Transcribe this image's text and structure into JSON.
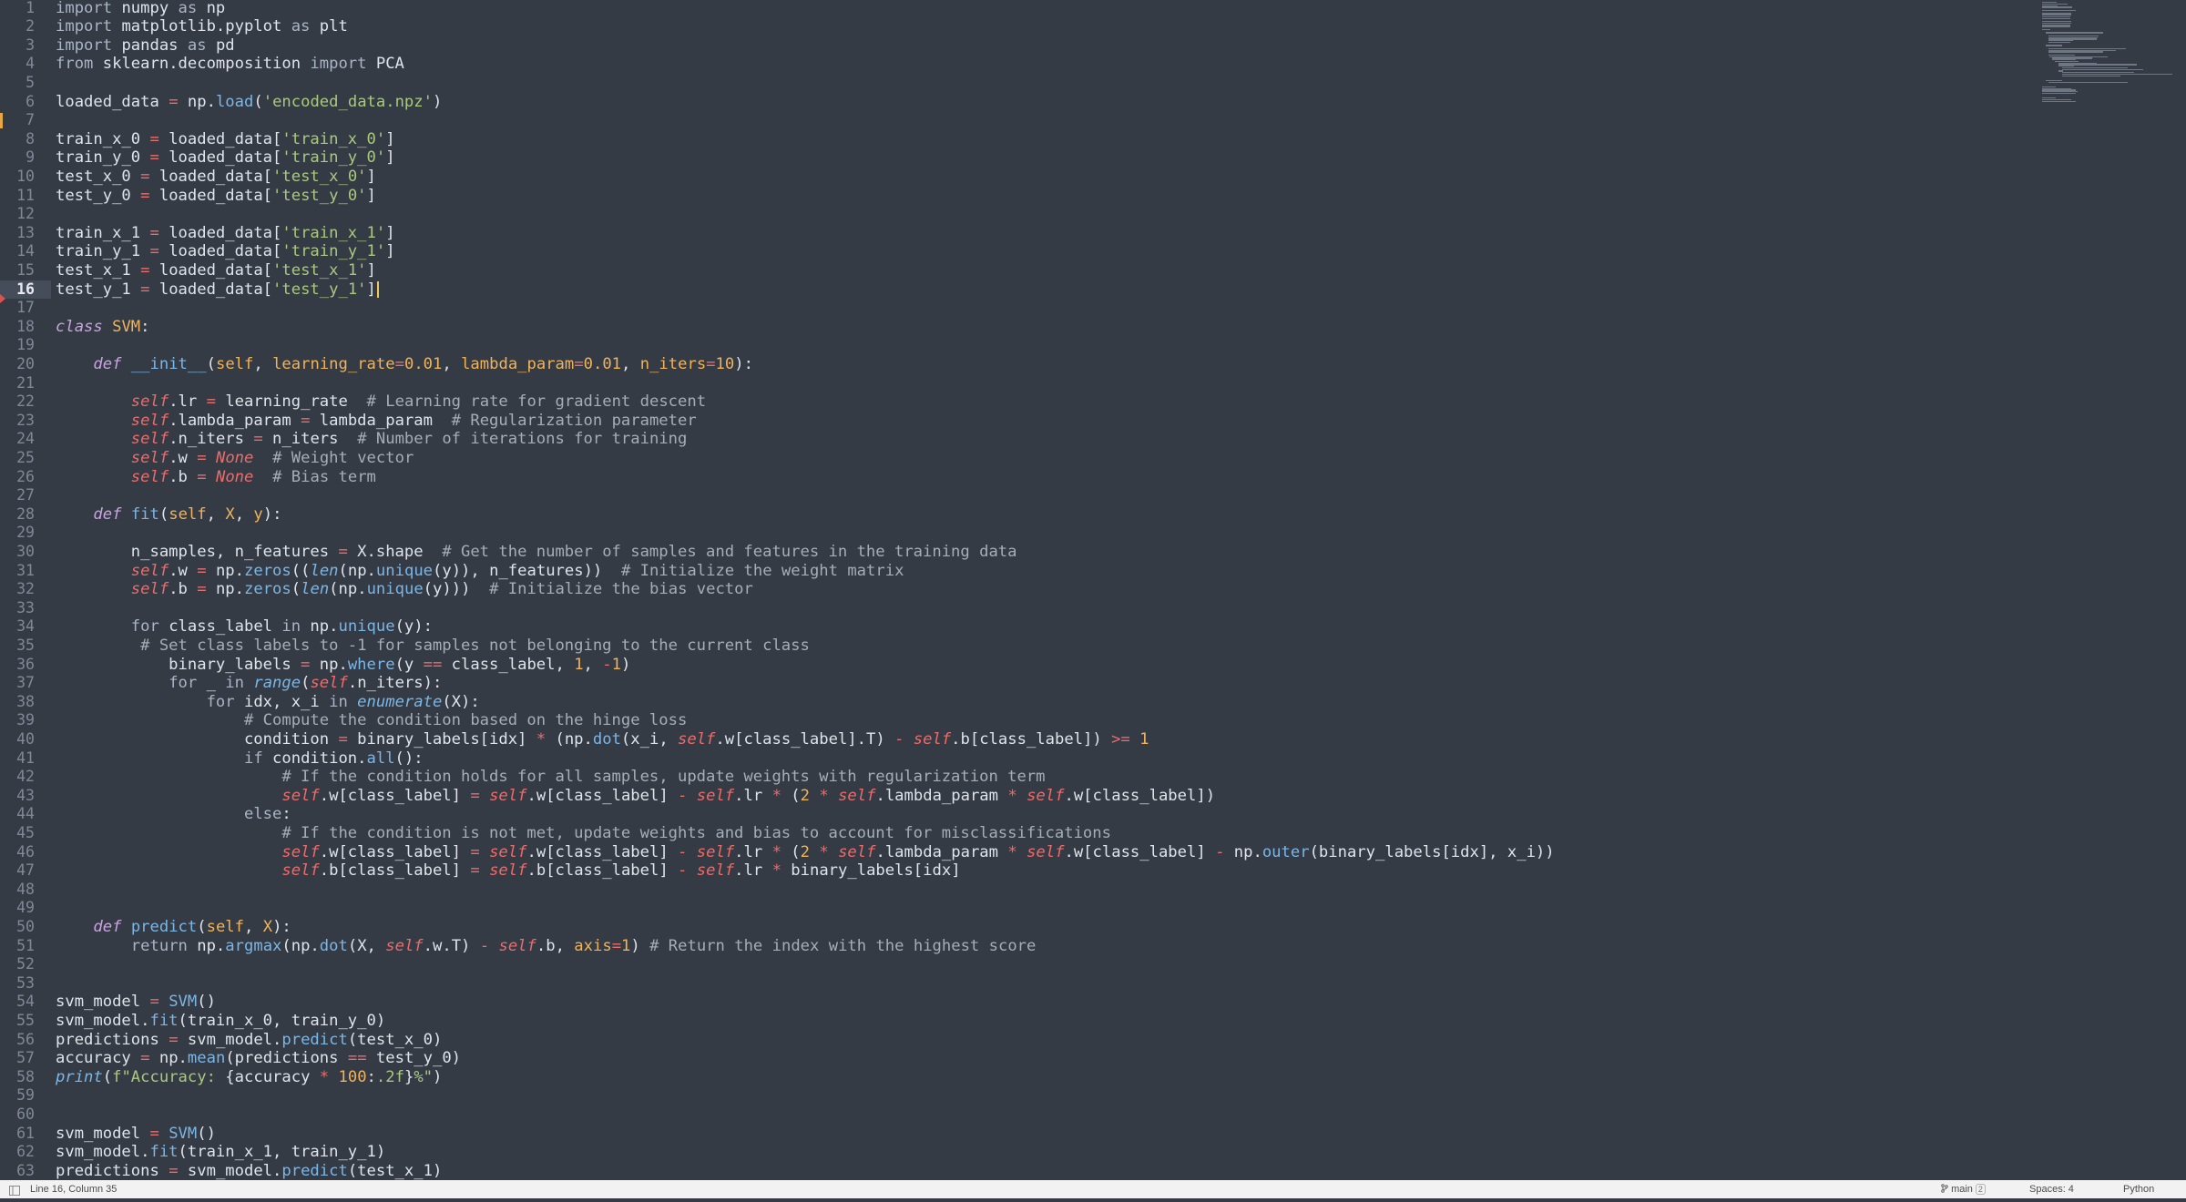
{
  "editor": {
    "current_line": 16,
    "lines": [
      "<span class=\"kw\">import</span> numpy <span class=\"kw\">as</span> np",
      "<span class=\"kw\">import</span> matplotlib.pyplot <span class=\"kw\">as</span> plt",
      "<span class=\"kw\">import</span> pandas <span class=\"kw\">as</span> pd",
      "<span class=\"kw\">from</span> sklearn.decomposition <span class=\"kw\">import</span> PCA",
      "",
      "loaded_data <span class=\"op\">=</span> np.<span class=\"fn\">load</span>(<span class=\"str\">'encoded_data.npz'</span>)",
      "",
      "train_x_0 <span class=\"op\">=</span> loaded_data[<span class=\"str\">'train_x_0'</span>]",
      "train_y_0 <span class=\"op\">=</span> loaded_data[<span class=\"str\">'train_y_0'</span>]",
      "test_x_0 <span class=\"op\">=</span> loaded_data[<span class=\"str\">'test_x_0'</span>]",
      "test_y_0 <span class=\"op\">=</span> loaded_data[<span class=\"str\">'test_y_0'</span>]",
      "",
      "train_x_1 <span class=\"op\">=</span> loaded_data[<span class=\"str\">'train_x_1'</span>]",
      "train_y_1 <span class=\"op\">=</span> loaded_data[<span class=\"str\">'train_y_1'</span>]",
      "test_x_1 <span class=\"op\">=</span> loaded_data[<span class=\"str\">'test_x_1'</span>]",
      "test_y_1 <span class=\"op\">=</span> loaded_data[<span class=\"str\">'test_y_1'</span>]<span class=\"cursor\" data-name=\"text-cursor\" data-interactable=\"false\"></span>",
      "",
      "<span class=\"kwi\">class</span> <span class=\"cls\">SVM</span>:",
      "",
      "    <span class=\"kwi\">def</span> <span class=\"fn\">__init__</span>(<span class=\"par\">self</span>, <span class=\"par\">learning_rate</span><span class=\"op\">=</span><span class=\"num\">0.01</span>, <span class=\"par\">lambda_param</span><span class=\"op\">=</span><span class=\"num\">0.01</span>, <span class=\"par\">n_iters</span><span class=\"op\">=</span><span class=\"num\">10</span>):",
      "",
      "        <span class=\"slf\">self</span>.lr <span class=\"op\">=</span> learning_rate  <span class=\"cm\"># Learning rate for gradient descent</span>",
      "        <span class=\"slf\">self</span>.lambda_param <span class=\"op\">=</span> lambda_param  <span class=\"cm\"># Regularization parameter</span>",
      "        <span class=\"slf\">self</span>.n_iters <span class=\"op\">=</span> n_iters  <span class=\"cm\"># Number of iterations for training</span>",
      "        <span class=\"slf\">self</span>.w <span class=\"op\">=</span> <span class=\"non\">None</span>  <span class=\"cm\"># Weight vector</span>",
      "        <span class=\"slf\">self</span>.b <span class=\"op\">=</span> <span class=\"non\">None</span>  <span class=\"cm\"># Bias term</span>",
      "",
      "    <span class=\"kwi\">def</span> <span class=\"fn\">fit</span>(<span class=\"par\">self</span>, <span class=\"par\">X</span>, <span class=\"par\">y</span>):",
      "",
      "        n_samples, n_features <span class=\"op\">=</span> X.shape  <span class=\"cm\"># Get the number of samples and features in the training data</span>",
      "        <span class=\"slf\">self</span>.w <span class=\"op\">=</span> np.<span class=\"fn\">zeros</span>((<span class=\"bi\">len</span>(np.<span class=\"fn\">unique</span>(y)), n_features))  <span class=\"cm\"># Initialize the weight matrix</span>",
      "        <span class=\"slf\">self</span>.b <span class=\"op\">=</span> np.<span class=\"fn\">zeros</span>(<span class=\"bi\">len</span>(np.<span class=\"fn\">unique</span>(y)))  <span class=\"cm\"># Initialize the bias vector</span>",
      "",
      "        <span class=\"kw\">for</span> class_label <span class=\"kw\">in</span> np.<span class=\"fn\">unique</span>(y):",
      "         <span class=\"cm\"># Set class labels to -1 for samples not belonging to the current class</span>",
      "            binary_labels <span class=\"op\">=</span> np.<span class=\"fn\">where</span>(y <span class=\"op\">==</span> class_label, <span class=\"num\">1</span>, <span class=\"op\">-</span><span class=\"num\">1</span>)",
      "            <span class=\"kw\">for</span> _ <span class=\"kw\">in</span> <span class=\"bi\">range</span>(<span class=\"slf\">self</span>.n_iters):",
      "                <span class=\"kw\">for</span> idx, x_i <span class=\"kw\">in</span> <span class=\"bi\">enumerate</span>(X):",
      "                    <span class=\"cm\"># Compute the condition based on the hinge loss</span>",
      "                    condition <span class=\"op\">=</span> binary_labels[idx] <span class=\"op\">*</span> (np.<span class=\"fn\">dot</span>(x_i, <span class=\"slf\">self</span>.w[class_label].T) <span class=\"op\">-</span> <span class=\"slf\">self</span>.b[class_label]) <span class=\"op\">&gt;=</span> <span class=\"num\">1</span>",
      "                    <span class=\"kw\">if</span> condition.<span class=\"fn\">all</span>():",
      "                        <span class=\"cm\"># If the condition holds for all samples, update weights with regularization term</span>",
      "                        <span class=\"slf\">self</span>.w[class_label] <span class=\"op\">=</span> <span class=\"slf\">self</span>.w[class_label] <span class=\"op\">-</span> <span class=\"slf\">self</span>.lr <span class=\"op\">*</span> (<span class=\"num\">2</span> <span class=\"op\">*</span> <span class=\"slf\">self</span>.lambda_param <span class=\"op\">*</span> <span class=\"slf\">self</span>.w[class_label])",
      "                    <span class=\"kw\">else</span>:",
      "                        <span class=\"cm\"># If the condition is not met, update weights and bias to account for misclassifications</span>",
      "                        <span class=\"slf\">self</span>.w[class_label] <span class=\"op\">=</span> <span class=\"slf\">self</span>.w[class_label] <span class=\"op\">-</span> <span class=\"slf\">self</span>.lr <span class=\"op\">*</span> (<span class=\"num\">2</span> <span class=\"op\">*</span> <span class=\"slf\">self</span>.lambda_param <span class=\"op\">*</span> <span class=\"slf\">self</span>.w[class_label] <span class=\"op\">-</span> np.<span class=\"fn\">outer</span>(binary_labels[idx], x_i))",
      "                        <span class=\"slf\">self</span>.b[class_label] <span class=\"op\">=</span> <span class=\"slf\">self</span>.b[class_label] <span class=\"op\">-</span> <span class=\"slf\">self</span>.lr <span class=\"op\">*</span> binary_labels[idx]",
      "",
      "",
      "    <span class=\"kwi\">def</span> <span class=\"fn\">predict</span>(<span class=\"par\">self</span>, <span class=\"par\">X</span>):",
      "        <span class=\"kw\">return</span> np.<span class=\"fn\">argmax</span>(np.<span class=\"fn\">dot</span>(X, <span class=\"slf\">self</span>.w.T) <span class=\"op\">-</span> <span class=\"slf\">self</span>.b, <span class=\"par\">axis</span><span class=\"op\">=</span><span class=\"num\">1</span>) <span class=\"cm\"># Return the index with the highest score</span>",
      "",
      "",
      "svm_model <span class=\"op\">=</span> <span class=\"fn\">SVM</span>()",
      "svm_model.<span class=\"fn\">fit</span>(train_x_0, train_y_0)",
      "predictions <span class=\"op\">=</span> svm_model.<span class=\"fn\">predict</span>(test_x_0)",
      "accuracy <span class=\"op\">=</span> np.<span class=\"fn\">mean</span>(predictions <span class=\"op\">==</span> test_y_0)",
      "<span class=\"bi\">print</span>(<span class=\"str\">f\"Accuracy: </span>{accuracy <span class=\"op\">*</span> <span class=\"num\">100</span>:<span class=\"str\">.2f</span>}<span class=\"str\">%\"</span>)",
      "",
      "",
      "svm_model <span class=\"op\">=</span> <span class=\"fn\">SVM</span>()",
      "svm_model.<span class=\"fn\">fit</span>(train_x_1, train_y_1)",
      "predictions <span class=\"op\">=</span> svm_model.<span class=\"fn\">predict</span>(test_x_1)"
    ]
  },
  "statusbar": {
    "position": "Line 16, Column 35",
    "branch": "main",
    "branch_badge": "2",
    "indent": "Spaces: 4",
    "syntax": "Python"
  },
  "colors": {
    "background": "#353b45",
    "statusbar": "#f2f2f2",
    "modified_marker": "#e5a842"
  }
}
